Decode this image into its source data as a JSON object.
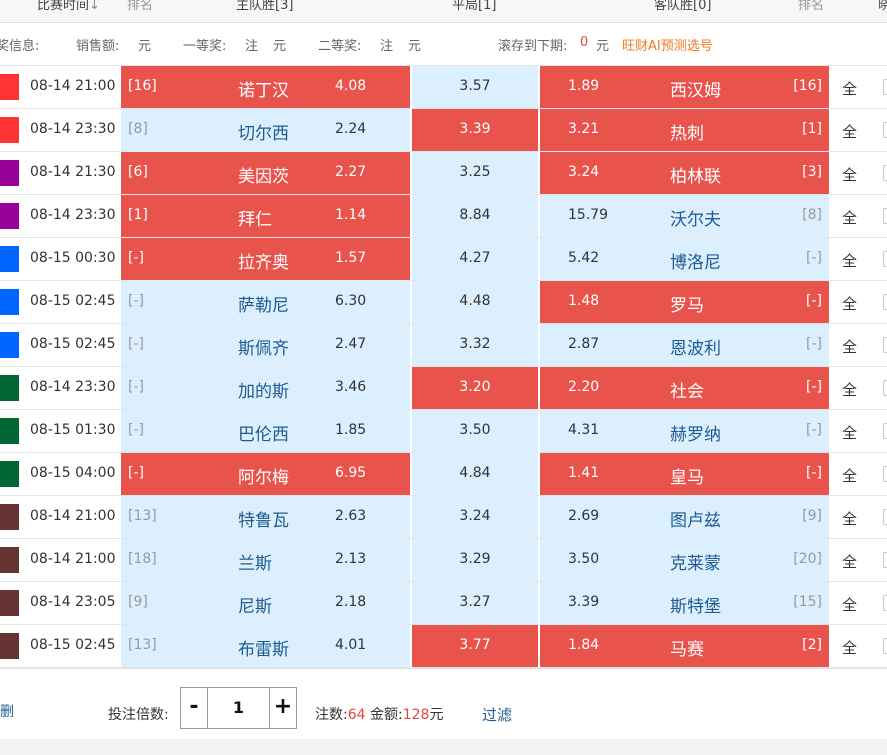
{
  "header": {
    "time": "比赛时间",
    "sort_icon": "sort-down-icon",
    "rank_left": "排名",
    "home_win": "主队胜[3]",
    "draw": "平局[1]",
    "away_win": "客队胜[0]",
    "rank_right": "排名",
    "cut": "晓"
  },
  "info": {
    "prize_info": "奖信息:",
    "sales": "销售额:",
    "sales_unit": "元",
    "first_prize": "一等奖:",
    "first_note": "注",
    "first_unit": "元",
    "second_prize": "二等奖:",
    "second_note": "注",
    "second_unit": "元",
    "rollover": "滚存到下期:",
    "rollover_value": "0",
    "rollover_unit": "元",
    "ai_link": "旺财AI预测选号"
  },
  "colors": {
    "selected": "#e8534c",
    "unselected": "#dcefff",
    "team_text": "#1d5b91"
  },
  "rows": [
    {
      "league_color": "#ff3333",
      "time": "08-14 21:00",
      "home_rank": "[16]",
      "home": "诺丁汉",
      "home_odds": "4.08",
      "draw_odds": "3.57",
      "away_odds": "1.89",
      "away": "西汉姆",
      "away_rank": "[16]",
      "sel": [
        true,
        false,
        true
      ],
      "all": "全"
    },
    {
      "league_color": "#ff3333",
      "time": "08-14 23:30",
      "home_rank": "[8]",
      "home": "切尔西",
      "home_odds": "2.24",
      "draw_odds": "3.39",
      "away_odds": "3.21",
      "away": "热刺",
      "away_rank": "[1]",
      "sel": [
        false,
        true,
        true
      ],
      "all": "全"
    },
    {
      "league_color": "#990099",
      "time": "08-14 21:30",
      "home_rank": "[6]",
      "home": "美因茨",
      "home_odds": "2.27",
      "draw_odds": "3.25",
      "away_odds": "3.24",
      "away": "柏林联",
      "away_rank": "[3]",
      "sel": [
        true,
        false,
        true
      ],
      "all": "全"
    },
    {
      "league_color": "#990099",
      "time": "08-14 23:30",
      "home_rank": "[1]",
      "home": "拜仁",
      "home_odds": "1.14",
      "draw_odds": "8.84",
      "away_odds": "15.79",
      "away": "沃尔夫",
      "away_rank": "[8]",
      "sel": [
        true,
        false,
        false
      ],
      "all": "全"
    },
    {
      "league_color": "#0066ff",
      "time": "08-15 00:30",
      "home_rank": "[-]",
      "home": "拉齐奥",
      "home_odds": "1.57",
      "draw_odds": "4.27",
      "away_odds": "5.42",
      "away": "博洛尼",
      "away_rank": "[-]",
      "sel": [
        true,
        false,
        false
      ],
      "all": "全"
    },
    {
      "league_color": "#0066ff",
      "time": "08-15 02:45",
      "home_rank": "[-]",
      "home": "萨勒尼",
      "home_odds": "6.30",
      "draw_odds": "4.48",
      "away_odds": "1.48",
      "away": "罗马",
      "away_rank": "[-]",
      "sel": [
        false,
        false,
        true
      ],
      "all": "全"
    },
    {
      "league_color": "#0066ff",
      "time": "08-15 02:45",
      "home_rank": "[-]",
      "home": "斯佩齐",
      "home_odds": "2.47",
      "draw_odds": "3.32",
      "away_odds": "2.87",
      "away": "恩波利",
      "away_rank": "[-]",
      "sel": [
        false,
        false,
        false
      ],
      "all": "全"
    },
    {
      "league_color": "#006633",
      "time": "08-14 23:30",
      "home_rank": "[-]",
      "home": "加的斯",
      "home_odds": "3.46",
      "draw_odds": "3.20",
      "away_odds": "2.20",
      "away": "社会",
      "away_rank": "[-]",
      "sel": [
        false,
        true,
        true
      ],
      "all": "全"
    },
    {
      "league_color": "#006633",
      "time": "08-15 01:30",
      "home_rank": "[-]",
      "home": "巴伦西",
      "home_odds": "1.85",
      "draw_odds": "3.50",
      "away_odds": "4.31",
      "away": "赫罗纳",
      "away_rank": "[-]",
      "sel": [
        false,
        false,
        false
      ],
      "all": "全"
    },
    {
      "league_color": "#006633",
      "time": "08-15 04:00",
      "home_rank": "[-]",
      "home": "阿尔梅",
      "home_odds": "6.95",
      "draw_odds": "4.84",
      "away_odds": "1.41",
      "away": "皇马",
      "away_rank": "[-]",
      "sel": [
        true,
        false,
        true
      ],
      "all": "全"
    },
    {
      "league_color": "#663333",
      "time": "08-14 21:00",
      "home_rank": "[13]",
      "home": "特鲁瓦",
      "home_odds": "2.63",
      "draw_odds": "3.24",
      "away_odds": "2.69",
      "away": "图卢兹",
      "away_rank": "[9]",
      "sel": [
        false,
        false,
        false
      ],
      "all": "全"
    },
    {
      "league_color": "#663333",
      "time": "08-14 21:00",
      "home_rank": "[18]",
      "home": "兰斯",
      "home_odds": "2.13",
      "draw_odds": "3.29",
      "away_odds": "3.50",
      "away": "克莱蒙",
      "away_rank": "[20]",
      "sel": [
        false,
        false,
        false
      ],
      "all": "全"
    },
    {
      "league_color": "#663333",
      "time": "08-14 23:05",
      "home_rank": "[9]",
      "home": "尼斯",
      "home_odds": "2.18",
      "draw_odds": "3.27",
      "away_odds": "3.39",
      "away": "斯特堡",
      "away_rank": "[15]",
      "sel": [
        false,
        false,
        false
      ],
      "all": "全"
    },
    {
      "league_color": "#663333",
      "time": "08-15 02:45",
      "home_rank": "[13]",
      "home": "布雷斯",
      "home_odds": "4.01",
      "draw_odds": "3.77",
      "away_odds": "1.84",
      "away": "马赛",
      "away_rank": "[2]",
      "sel": [
        false,
        true,
        true
      ],
      "all": "全"
    }
  ],
  "footer": {
    "delete": "删",
    "multiplier_label": "投注倍数:",
    "minus": "-",
    "multiplier": "1",
    "plus": "+",
    "bets_label": "注数:",
    "bets": "64",
    "amount_label": "金额:",
    "amount": "128",
    "amount_unit": "元",
    "filter": "过滤"
  }
}
